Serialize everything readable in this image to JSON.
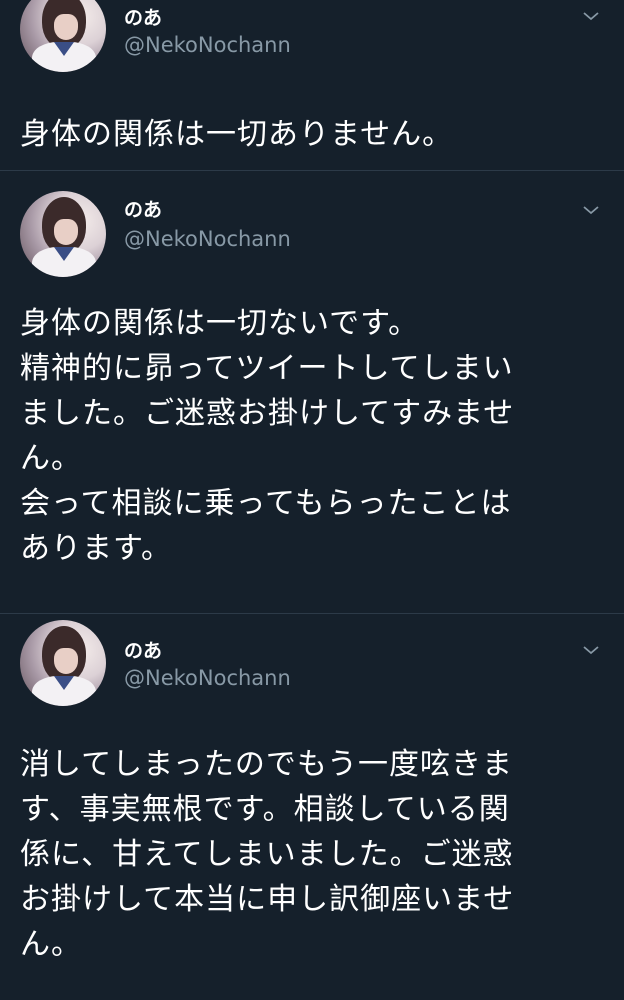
{
  "tweets": [
    {
      "display_name": "のあ",
      "handle": "@NekoNochann",
      "text": "身体の関係は一切ありません。",
      "menu_icon": "chevron-down-icon"
    },
    {
      "display_name": "のあ",
      "handle": "@NekoNochann",
      "text": "身体の関係は一切ないです。\n精神的に昴ってツイートしてしまい\nました。ご迷惑お掛けしてすみませ\nん。\n会って相談に乗ってもらったことは\nあります。",
      "menu_icon": "chevron-down-icon"
    },
    {
      "display_name": "のあ",
      "handle": "@NekoNochann",
      "text": "消してしまったのでもう一度呟きま\nす、事実無根です。相談している関\n係に、甘えてしまいました。ご迷惑\nお掛けして本当に申し訳御座いませ\nん。",
      "menu_icon": "chevron-down-icon"
    }
  ],
  "colors": {
    "background": "#15202b",
    "secondary_text": "#8899a6",
    "divider": "#2c3a48"
  }
}
